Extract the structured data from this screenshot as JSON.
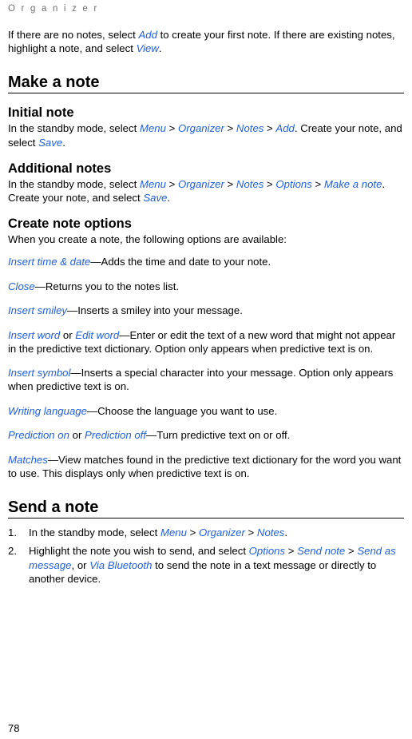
{
  "running_head": "O r g a n i z e r",
  "page_number": "78",
  "intro": {
    "t1": "If there are no notes, select ",
    "b1": "Add",
    "t2": " to create your first note. If there are existing notes, highlight a note, and select ",
    "b2": "View",
    "t3": "."
  },
  "section_make_a_note": {
    "title": "Make a note",
    "initial_note": {
      "title": "Initial note",
      "t1": "In the standby mode, select ",
      "b1": "Menu",
      "t2": " > ",
      "b2": "Organizer",
      "t3": " > ",
      "b3": "Notes",
      "t4": " > ",
      "b4": "Add",
      "t5": ". Create your note, and select ",
      "b5": "Save",
      "t6": "."
    },
    "additional_notes": {
      "title": "Additional notes",
      "t1": "In the standby mode, select ",
      "b1": "Menu",
      "t2": " > ",
      "b2": "Organizer",
      "t3": " > ",
      "b3": "Notes",
      "t4": " > ",
      "b4": "Options",
      "t5": " > ",
      "b5": "Make a note",
      "t6": ". Create your note, and select ",
      "b6": "Save",
      "t7": "."
    },
    "create_note_options": {
      "title": "Create note options",
      "lead": "When you create a note, the following options are available:",
      "options": [
        {
          "term": "Insert time & date",
          "desc": "—Adds the time and date to your note."
        },
        {
          "term": "Close",
          "desc": "—Returns you to the notes list."
        },
        {
          "term": "Insert smiley",
          "desc": "—Inserts a smiley into your message."
        },
        {
          "term": "Insert word",
          "joiner": " or ",
          "term2": "Edit word",
          "desc": "—Enter or edit the text of a new word that might not appear in the predictive text dictionary. Option only appears when predictive text is on."
        },
        {
          "term": "Insert symbol",
          "desc": "—Inserts a special character into your message. Option only appears when predictive text is on."
        },
        {
          "term": "Writing language",
          "desc": "—Choose the language you want to use."
        },
        {
          "term": "Prediction on",
          "joiner": " or ",
          "term2": "Prediction off",
          "desc": "—Turn predictive text on or off."
        },
        {
          "term": "Matches",
          "desc": "—View matches found in the predictive text dictionary for the word you want to use. This displays only when predictive text is on."
        }
      ]
    }
  },
  "section_send_a_note": {
    "title": "Send a note",
    "steps": [
      {
        "num": "1.",
        "t1": "In the standby mode, select ",
        "b1": "Menu",
        "t2": " > ",
        "b2": "Organizer",
        "t3": " > ",
        "b3": "Notes",
        "t4": "."
      },
      {
        "num": "2.",
        "t1": "Highlight the note you wish to send, and select ",
        "b1": "Options",
        "t2": " > ",
        "b2": "Send note",
        "t3": " > ",
        "b3": "Send as message",
        "t4": ", or ",
        "b4": "Via Bluetooth",
        "t5": " to send the note in a text message or directly to another device."
      }
    ]
  }
}
